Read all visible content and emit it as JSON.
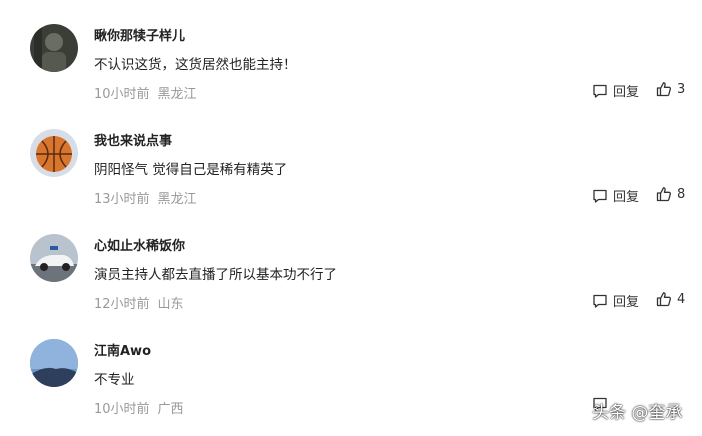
{
  "comments": [
    {
      "username": "瞅你那犊子样儿",
      "text": "不认识这货，这货居然也能主持！",
      "time": "10小时前",
      "location": "黑龙江",
      "reply_label": "回复",
      "likes": "3"
    },
    {
      "username": "我也来说点事",
      "text": "阴阳怪气 觉得自己是稀有精英了",
      "time": "13小时前",
      "location": "黑龙江",
      "reply_label": "回复",
      "likes": "8"
    },
    {
      "username": "心如止水稀饭你",
      "text": "演员主持人都去直播了所以基本功不行了",
      "time": "12小时前",
      "location": "山东",
      "reply_label": "回复",
      "likes": "4"
    },
    {
      "username": "江南Awo",
      "text": "不专业",
      "time": "10小时前",
      "location": "广西"
    }
  ],
  "watermark": "头条 @奎承",
  "icons": {
    "reply": "comment-bubble-icon",
    "like": "thumbs-up-icon"
  }
}
